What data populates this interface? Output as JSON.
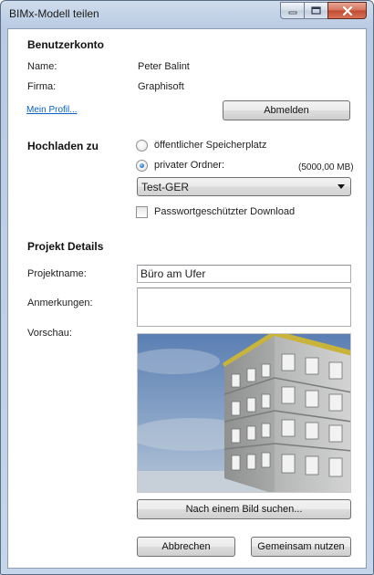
{
  "window": {
    "title": "BIMx-Modell teilen"
  },
  "account": {
    "heading": "Benutzerkonto",
    "name_label": "Name:",
    "name_value": "Peter Balint",
    "company_label": "Firma:",
    "company_value": "Graphisoft",
    "profile_link": "Mein Profil...",
    "logout_button": "Abmelden"
  },
  "upload": {
    "heading": "Hochladen zu",
    "public_option": "öffentlicher Speicherplatz",
    "private_option": "privater Ordner:",
    "selected_option": "private",
    "quota": "(5000,00 MB)",
    "folder_selected": "Test-GER",
    "password_label": "Passwortgeschützter Download",
    "password_checked": false
  },
  "project": {
    "heading": "Projekt Details",
    "name_label": "Projektname:",
    "name_value": "Büro am Ufer",
    "notes_label": "Anmerkungen:",
    "notes_value": "",
    "preview_label": "Vorschau:",
    "browse_button": "Nach einem Bild suchen..."
  },
  "footer": {
    "cancel_button": "Abbrechen",
    "share_button": "Gemeinsam nutzen"
  },
  "icons": {
    "minimize": "minimize-icon",
    "maximize": "maximize-icon",
    "close": "close-icon",
    "dropdown": "chevron-down-icon"
  },
  "colors": {
    "link": "#0b5fbf",
    "title_bar": "#c5d5ea",
    "close_button": "#c24a31"
  }
}
